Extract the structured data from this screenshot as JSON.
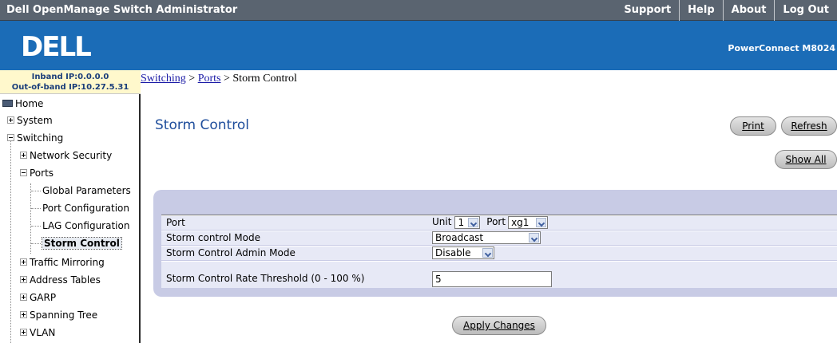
{
  "header": {
    "app_title": "Dell OpenManage Switch Administrator",
    "nav": [
      "Support",
      "Help",
      "About",
      "Log Out"
    ]
  },
  "banner": {
    "logo_text": "DELL",
    "product": "PowerConnect M8024"
  },
  "ip_info": {
    "inband": "Inband IP:0.0.0.0",
    "oob": "Out-of-band IP:10.27.5.31"
  },
  "breadcrumb": {
    "items": [
      "Switching",
      "Ports"
    ],
    "separator": " > ",
    "current": "Storm Control"
  },
  "tree": {
    "home": "Home",
    "system": "System",
    "switching": "Switching",
    "network_security": "Network Security",
    "ports": "Ports",
    "global_parameters": "Global Parameters",
    "port_configuration": "Port Configuration",
    "lag_configuration": "LAG Configuration",
    "storm_control": "Storm Control",
    "traffic_mirroring": "Traffic Mirroring",
    "address_tables": "Address Tables",
    "garp": "GARP",
    "spanning_tree": "Spanning Tree",
    "vlan": "VLAN"
  },
  "page": {
    "title": "Storm Control",
    "print": "Print",
    "refresh": "Refresh",
    "show_all": "Show All",
    "apply": "Apply Changes"
  },
  "form": {
    "port_label": "Port",
    "unit_label": "Unit",
    "unit_value": "1",
    "port_field_label": "Port",
    "port_value": "xg1",
    "mode_label": "Storm control Mode",
    "mode_value": "Broadcast",
    "admin_label": "Storm Control Admin Mode",
    "admin_value": "Disable",
    "threshold_label": "Storm Control Rate Threshold (0 - 100 %)",
    "threshold_value": "5"
  },
  "colors": {
    "topbar": "#5a6470",
    "banner": "#1b6cb7",
    "title": "#1f4e9c",
    "panel": "#c8cbe5"
  }
}
